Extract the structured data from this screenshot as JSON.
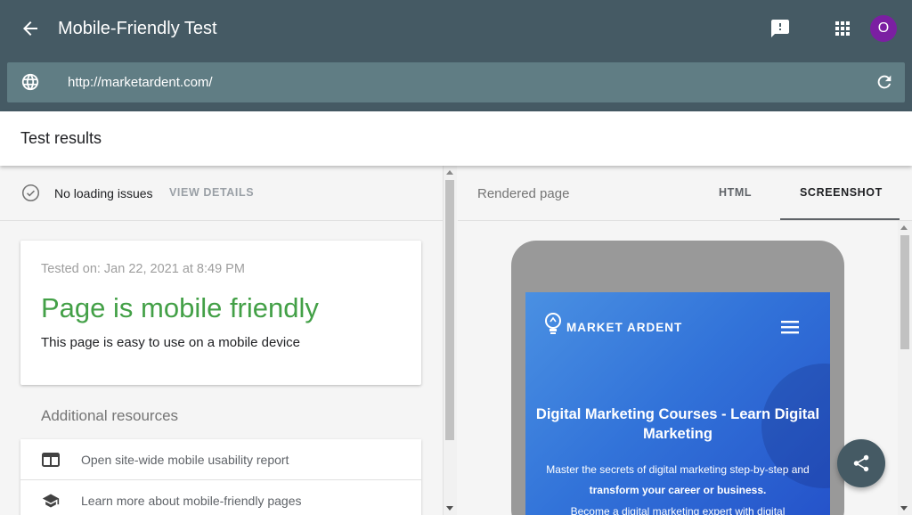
{
  "app": {
    "title": "Mobile-Friendly Test",
    "avatar_letter": "O",
    "avatar_color": "#7b1fa2",
    "header_color": "#455a64"
  },
  "urlbar": {
    "value": "http://marketardent.com/",
    "icon": "globe-icon"
  },
  "results": {
    "title": "Test results",
    "status_text": "No loading issues",
    "view_details": "VIEW DETAILS"
  },
  "result_card": {
    "tested_on": "Tested on: Jan 22, 2021 at 8:49 PM",
    "verdict": "Page is mobile friendly",
    "verdict_color": "#43a047",
    "description": "This page is easy to use on a mobile device"
  },
  "resources": {
    "title": "Additional resources",
    "items": [
      {
        "label": "Open site-wide mobile usability report",
        "icon": "report-window-icon"
      },
      {
        "label": "Learn more about mobile-friendly pages",
        "icon": "graduation-cap-icon"
      }
    ]
  },
  "right_pane": {
    "label": "Rendered page",
    "tabs": [
      {
        "label": "HTML",
        "selected": false
      },
      {
        "label": "SCREENSHOT",
        "selected": true
      }
    ]
  },
  "preview": {
    "brand": "MARKET ARDENT",
    "hero_title": "Digital Marketing Courses - Learn Digital Marketing",
    "line1": "Master the secrets of digital marketing step-by-step and",
    "line2": "transform your career or business.",
    "line3": "Become a digital marketing expert with digital"
  }
}
